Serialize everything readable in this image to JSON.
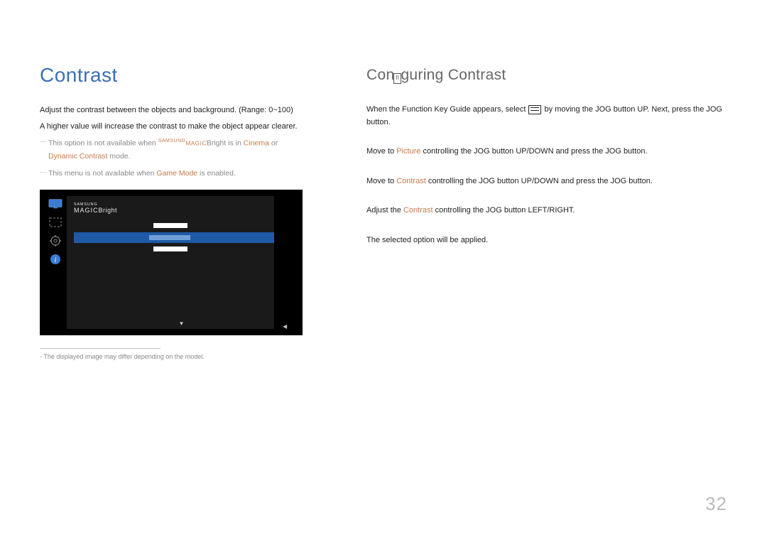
{
  "left": {
    "heading": "Contrast",
    "desc1": "Adjust the contrast between the objects and background. (Range: 0~100)",
    "desc2": "A higher value will increase the contrast to make the object appear clearer.",
    "note1_pre": "This option is not available when ",
    "note1_sams": "SAMSUNG",
    "note1_magic": "MAGIC",
    "note1_bright": "Bright",
    "note1_mid": " is in ",
    "note1_cinema": "Cinema",
    "note1_or": " or ",
    "note1_dc": "Dynamic Contrast",
    "note1_mode": " mode.",
    "note2_pre": "This menu is not available when ",
    "note2_gm": "Game Mode",
    "note2_post": " is enabled.",
    "menu_sams": "SAMSUNG",
    "menu_magic": "MAGIC",
    "menu_bright": "Bright",
    "footnote": "- The displayed image may differ depending on the model."
  },
  "right": {
    "heading_pre": "Con",
    "heading_glyph": "fi",
    "heading_post": "guring Contrast",
    "step1a": "When the Function Key Guide appears, select ",
    "step1b": " by moving the JOG button UP. Next, press the JOG button.",
    "step2a": "Move to ",
    "step2_picture": "Picture",
    "step2b": " controlling the JOG button UP/DOWN and press the JOG button.",
    "step3a": "Move to ",
    "step3_contrast": "Contrast",
    "step3b": " controlling the JOG button UP/DOWN and press the JOG button.",
    "step4a": "Adjust the ",
    "step4_contrast": "Contrast",
    "step4b": " controlling the JOG button LEFT/RIGHT.",
    "step5": "The selected option will be applied."
  },
  "page_number": "32"
}
